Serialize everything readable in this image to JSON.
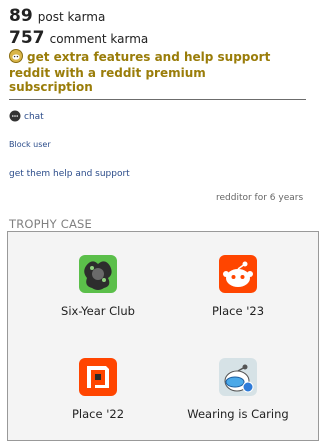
{
  "karma": {
    "post_value": "89",
    "post_label": "post karma",
    "comment_value": "757",
    "comment_label": "comment karma"
  },
  "premium_text": "get extra features and help support reddit with a reddit premium subscription",
  "actions": {
    "chat": "chat",
    "block_user": "Block user",
    "help": "get them help and support"
  },
  "age_text": "redditor for 6 years",
  "trophy_case": {
    "title": "TROPHY CASE",
    "trophies": [
      {
        "name": "Six-Year Club",
        "icon": "six-year-club-icon"
      },
      {
        "name": "Place '23",
        "icon": "place-23-icon"
      },
      {
        "name": "Place '22",
        "icon": "place-22-icon"
      },
      {
        "name": "Wearing is Caring",
        "icon": "wearing-is-caring-icon"
      }
    ]
  },
  "colors": {
    "link": "#2b4c8a",
    "premium": "#9a7d0a",
    "place23": "#ff4500",
    "place22": "#ff4500",
    "six_year": "#46a050"
  }
}
